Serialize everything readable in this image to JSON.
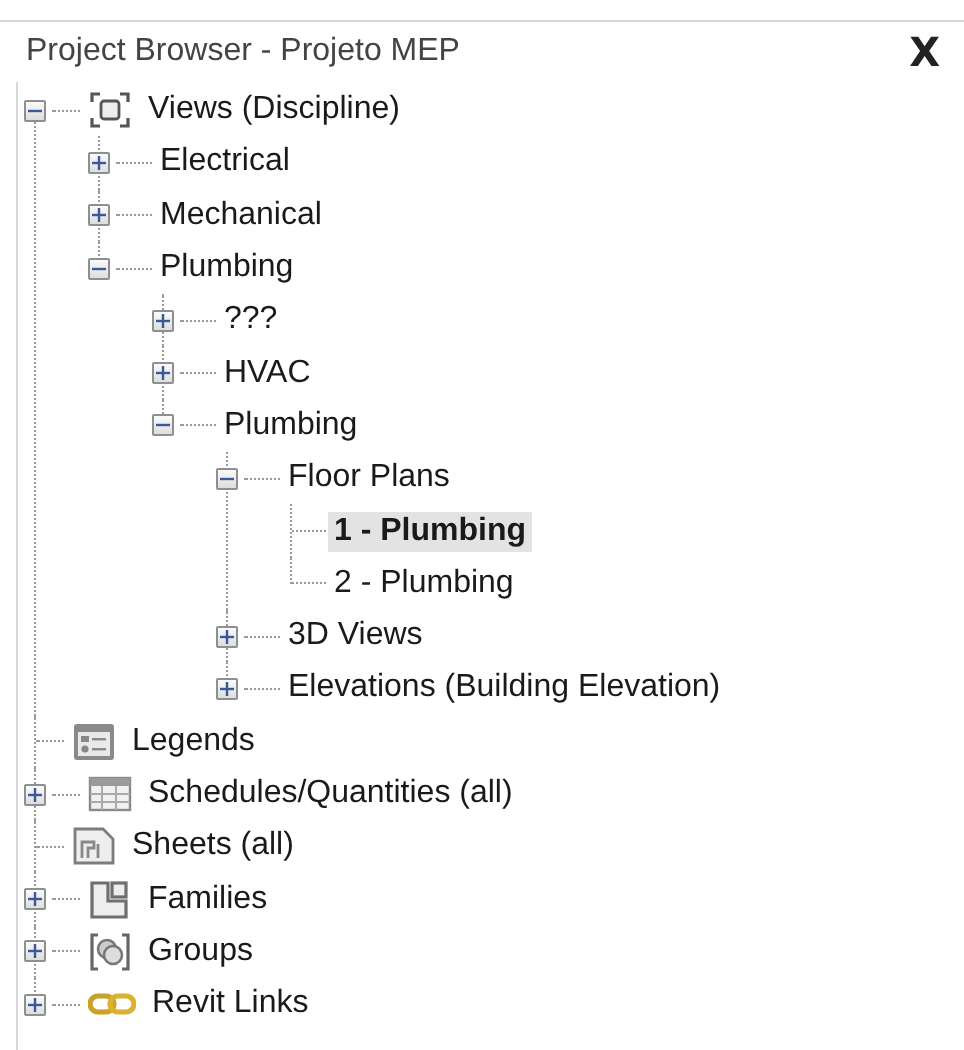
{
  "panel": {
    "title": "Project Browser - Projeto MEP",
    "close": "X"
  },
  "tree": [
    {
      "label": "Views (Discipline)",
      "kind": "views",
      "expanded": true,
      "selected": false,
      "children": [
        {
          "label": "Electrical",
          "expanded": false,
          "selected": false
        },
        {
          "label": "Mechanical",
          "expanded": false,
          "selected": false
        },
        {
          "label": "Plumbing",
          "expanded": true,
          "selected": false,
          "children": [
            {
              "label": "???",
              "expanded": false,
              "selected": false
            },
            {
              "label": "HVAC",
              "expanded": false,
              "selected": false
            },
            {
              "label": "Plumbing",
              "expanded": true,
              "selected": false,
              "children": [
                {
                  "label": "Floor Plans",
                  "expanded": true,
                  "selected": false,
                  "children": [
                    {
                      "label": "1 - Plumbing",
                      "selected": true
                    },
                    {
                      "label": "2 - Plumbing",
                      "selected": false
                    }
                  ]
                },
                {
                  "label": "3D Views",
                  "expanded": false,
                  "selected": false
                },
                {
                  "label": "Elevations (Building Elevation)",
                  "expanded": false,
                  "selected": false
                }
              ]
            }
          ]
        }
      ]
    },
    {
      "label": "Legends",
      "kind": "legends",
      "selected": false
    },
    {
      "label": "Schedules/Quantities (all)",
      "kind": "schedules",
      "expanded": false,
      "selected": false
    },
    {
      "label": "Sheets (all)",
      "kind": "sheets",
      "selected": false
    },
    {
      "label": "Families",
      "kind": "families",
      "expanded": false,
      "selected": false
    },
    {
      "label": "Groups",
      "kind": "groups",
      "expanded": false,
      "selected": false
    },
    {
      "label": "Revit Links",
      "kind": "links",
      "expanded": false,
      "selected": false
    }
  ]
}
